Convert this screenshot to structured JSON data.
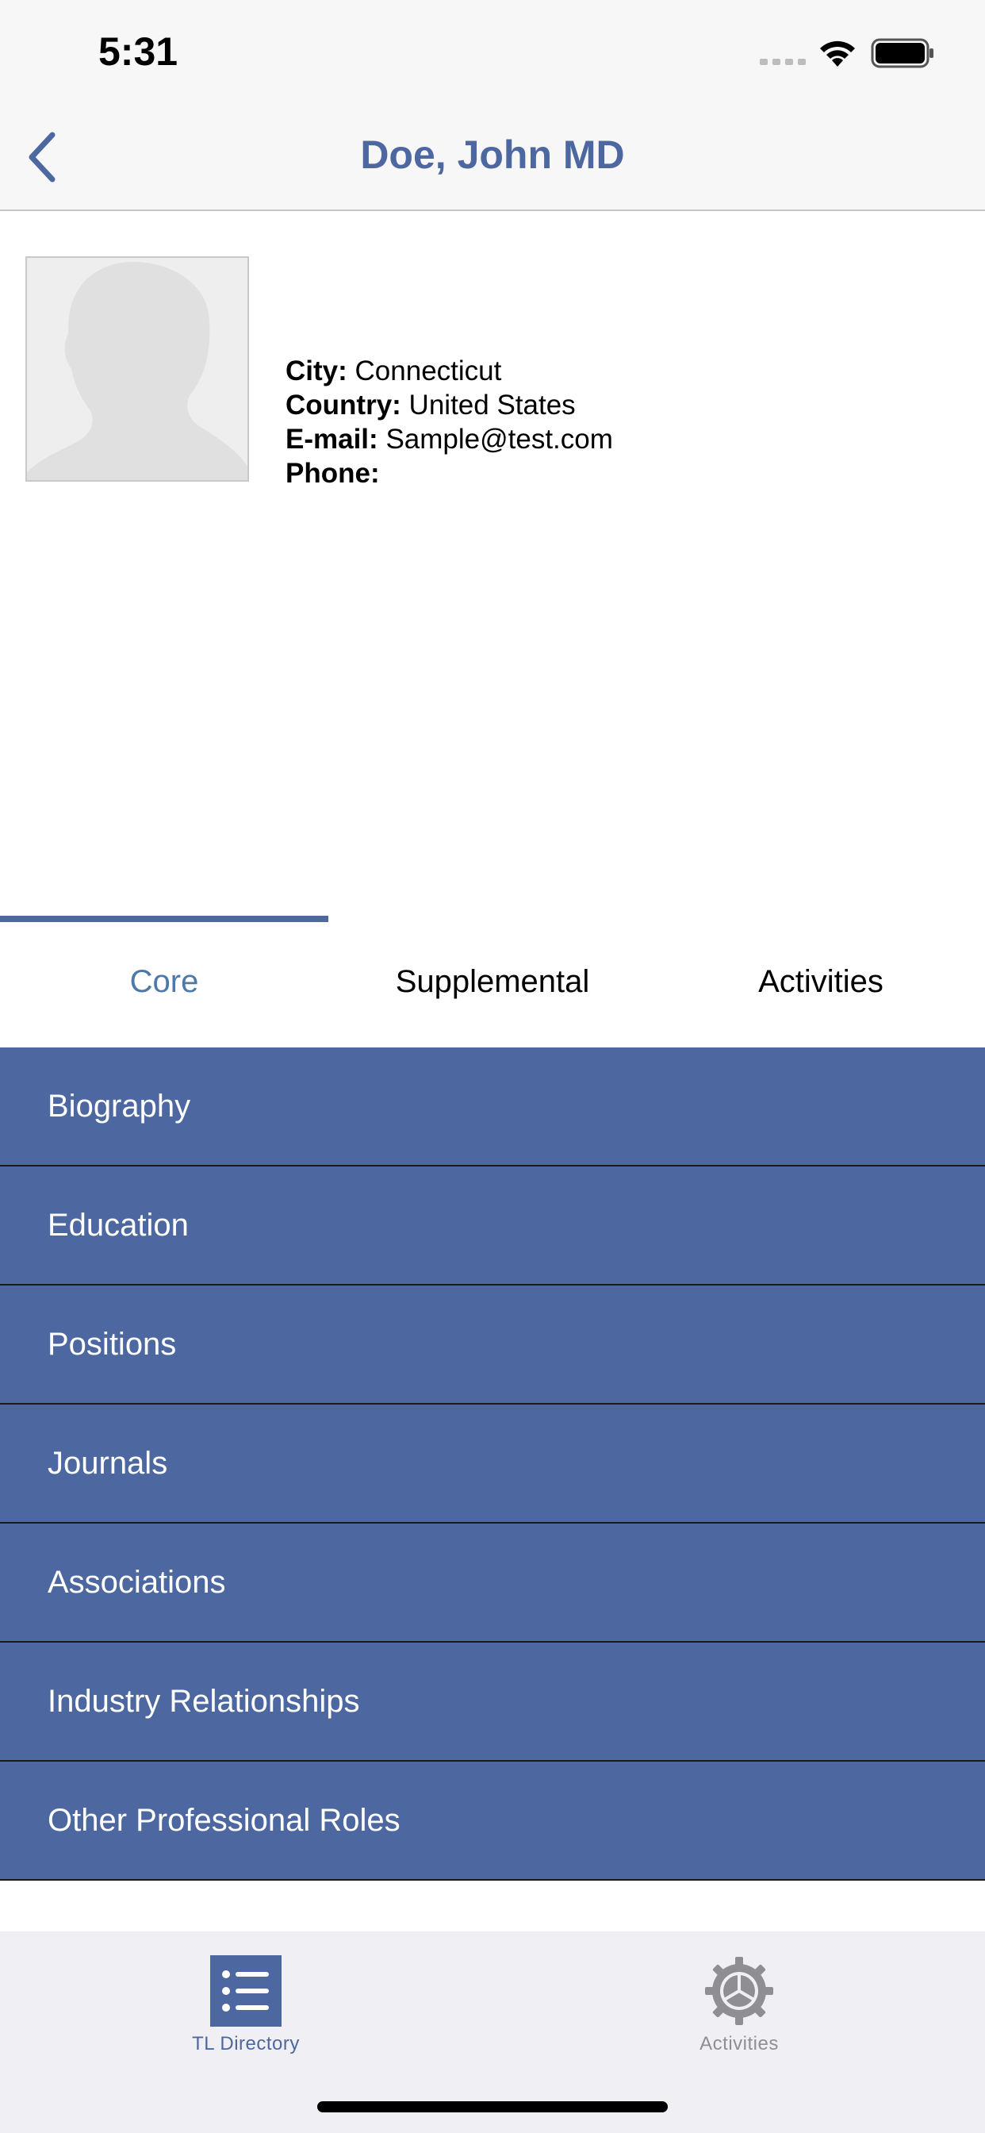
{
  "status_bar": {
    "time": "5:31"
  },
  "nav": {
    "title": "Doe, John MD",
    "back_icon": "chevron-left-icon"
  },
  "profile": {
    "fields": [
      {
        "label": "City:",
        "value": "Connecticut"
      },
      {
        "label": "Country:",
        "value": "United States"
      },
      {
        "label": "E-mail:",
        "value": "Sample@test.com"
      },
      {
        "label": "Phone:",
        "value": ""
      }
    ]
  },
  "tabs": [
    {
      "label": "Core",
      "active": true
    },
    {
      "label": "Supplemental",
      "active": false
    },
    {
      "label": "Activities",
      "active": false
    }
  ],
  "sections": [
    "Biography",
    "Education",
    "Positions",
    "Journals",
    "Associations",
    "Industry Relationships",
    "Other Professional Roles"
  ],
  "bottom_tabs": [
    {
      "label": "TL Directory",
      "icon": "list-icon",
      "active": true
    },
    {
      "label": "Activities",
      "icon": "gear-icon",
      "active": false
    }
  ],
  "colors": {
    "accent": "#4d68a0",
    "active_tab_text": "#4d79a8",
    "inactive_bottom": "#8e8e93"
  }
}
